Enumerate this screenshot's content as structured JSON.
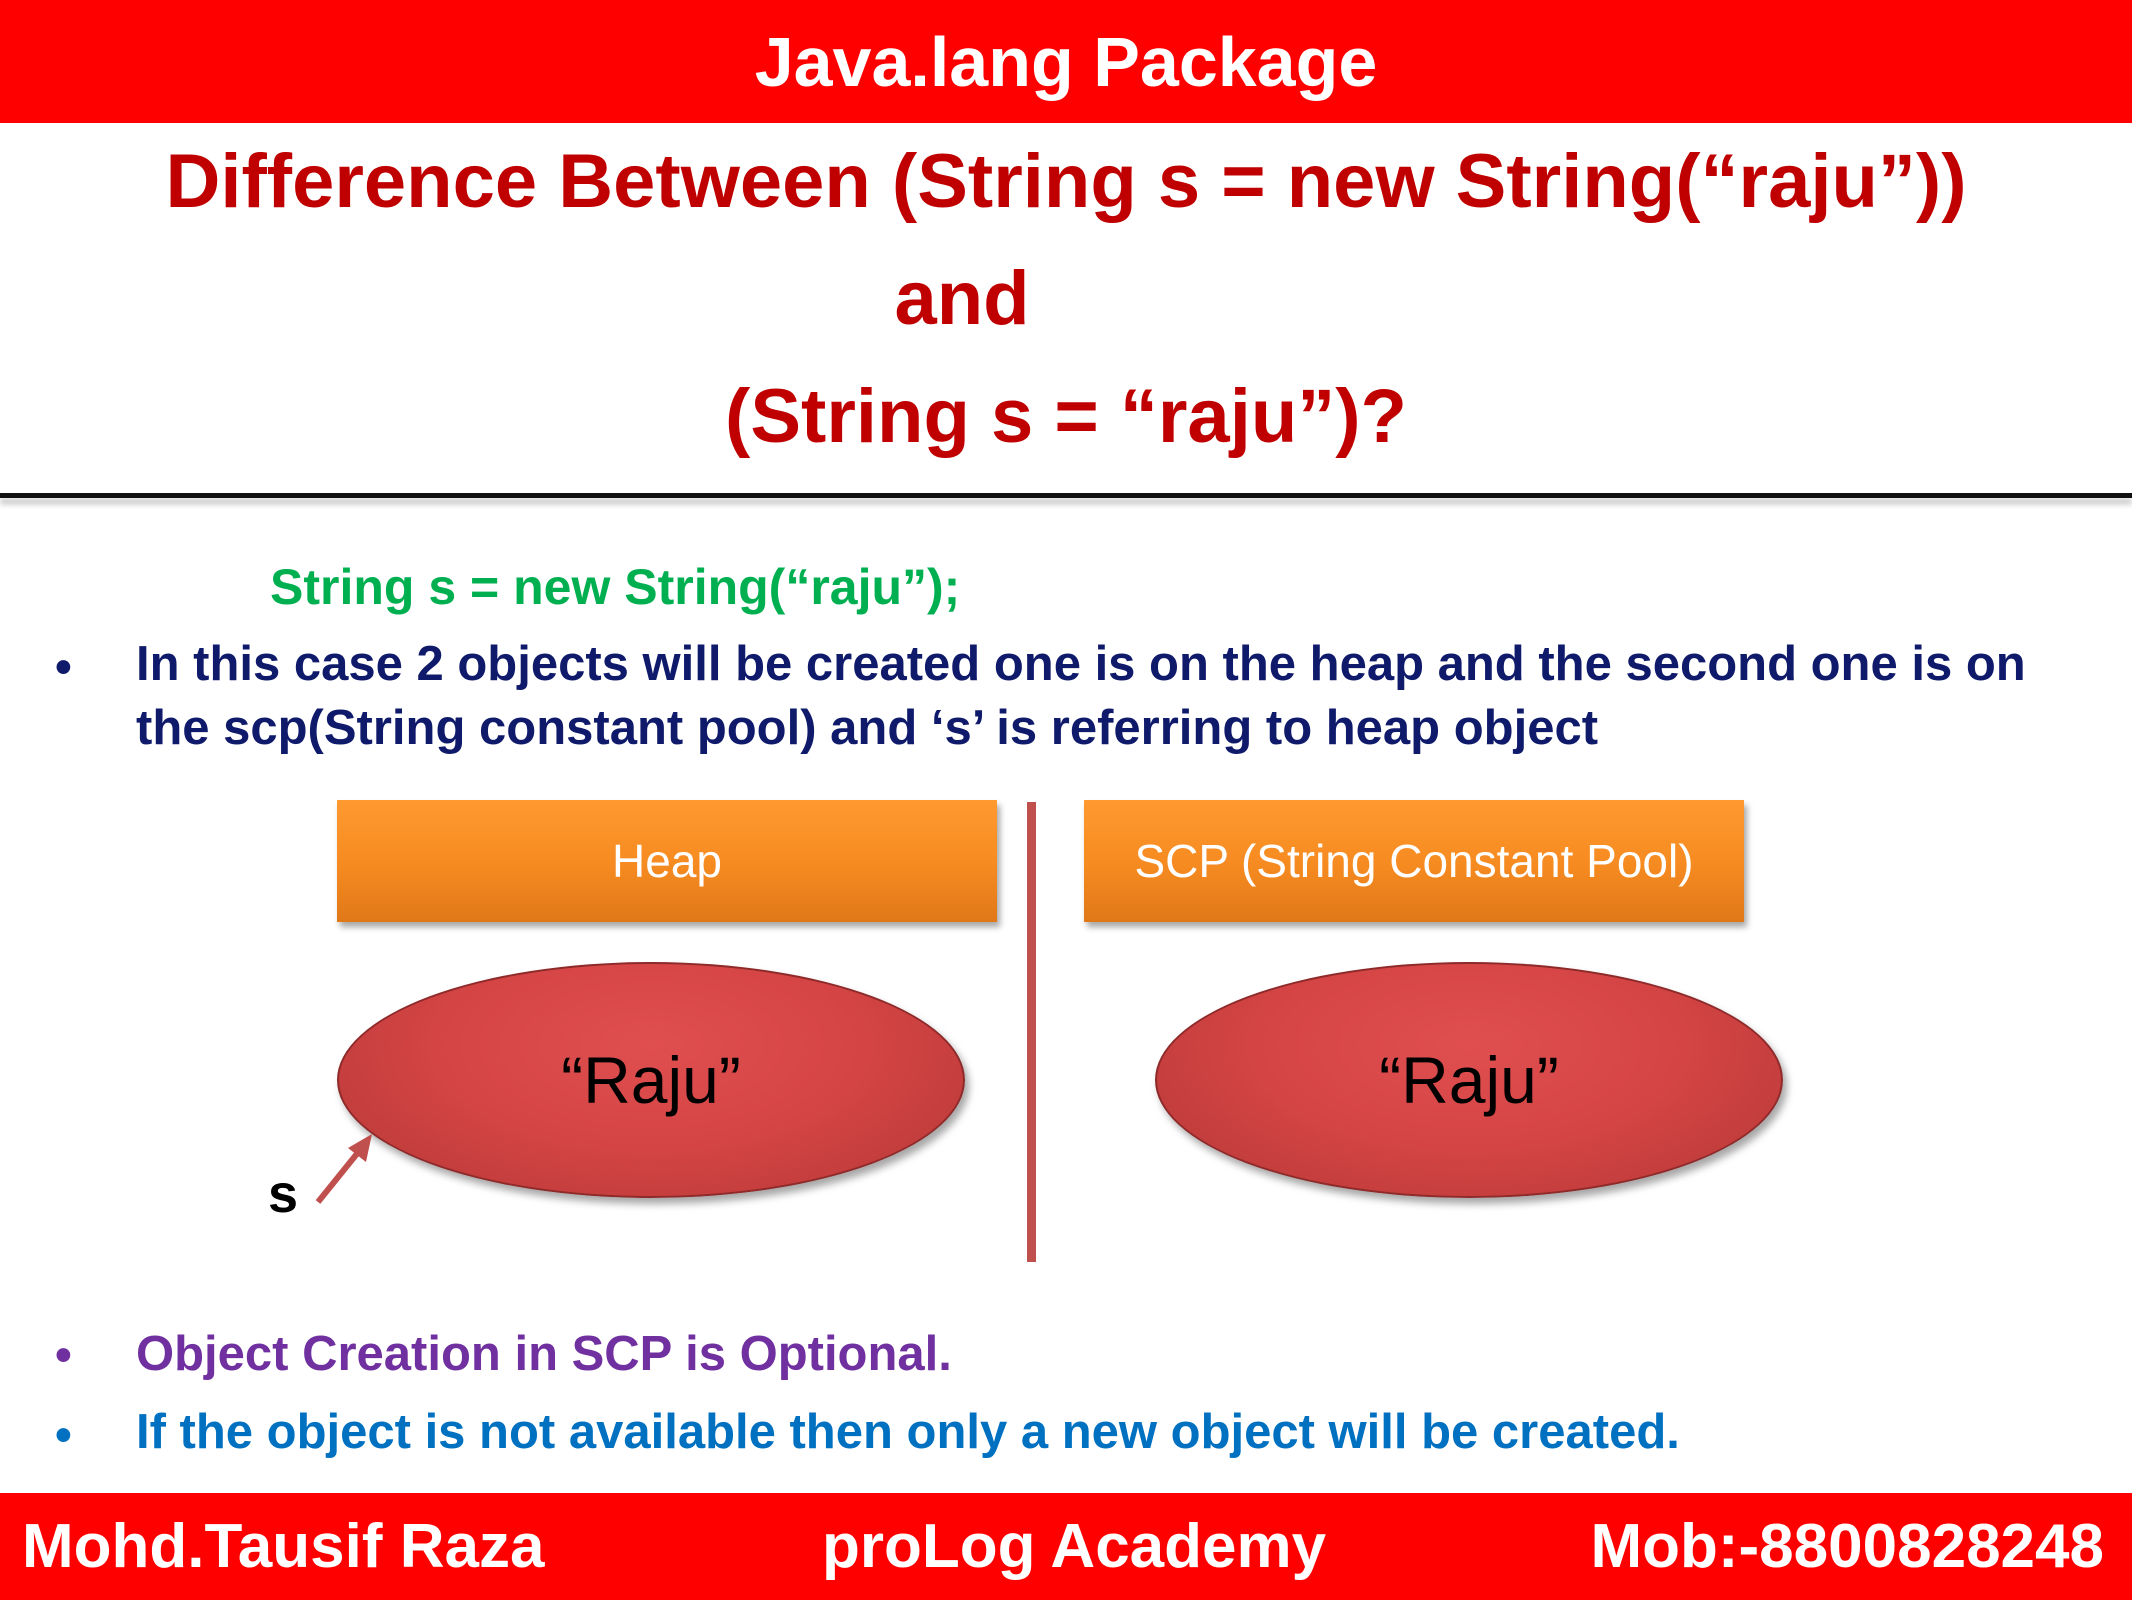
{
  "header": {
    "title": "Java.lang Package"
  },
  "question": {
    "line1": "Difference Between (String s = new String(“raju”))",
    "line2": "and",
    "line3": "(String s = “raju”)?"
  },
  "code": "String s = new String(“raju”);",
  "bullets": {
    "b1": "In this case 2 objects will be created one is on the heap and the second one is on the scp(String constant pool) and ‘s’ is referring to heap object",
    "b2": "Object Creation in SCP is Optional.",
    "b3": "If the object is not available then only a new object will be created."
  },
  "diagram": {
    "heap_label": "Heap",
    "scp_label": "SCP (String Constant Pool)",
    "heap_object": "“Raju”",
    "scp_object": "“Raju”",
    "reference": "s"
  },
  "footer": {
    "author": "Mohd.Tausif Raza",
    "academy": "proLog Academy",
    "mobile": "Mob:-8800828248"
  },
  "colors": {
    "bar": "#ff0000",
    "title": "#c00000",
    "code": "#00b050",
    "bullet1": "#0f1a6b",
    "bullet2": "#7030a0",
    "bullet3": "#0070c0",
    "box": "#f58a20",
    "oval": "#d64545"
  }
}
